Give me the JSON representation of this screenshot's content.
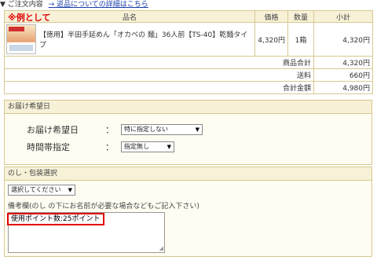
{
  "header": {
    "title": "▼ ご注文内容",
    "link": "→ 返品についての詳細はこちら"
  },
  "order_table": {
    "example_label": "※例として",
    "columns": [
      "品名",
      "価格",
      "数量",
      "小計"
    ],
    "item": {
      "name": "【徳用】半田手延めん「オカベの 麺」36人前【TS-40】乾麺タイプ",
      "price": "4,320円",
      "qty": "1箱",
      "subtotal": "4,320円"
    },
    "summary": [
      {
        "label": "商品合計",
        "value": "4,320円"
      },
      {
        "label": "送料",
        "value": "660円"
      },
      {
        "label": "合計金額",
        "value": "4,980円"
      }
    ]
  },
  "delivery": {
    "title": "お届け希望日",
    "date_label": "お届け希望日",
    "date_colon": "：",
    "date_value": "特に指定しない",
    "time_label": "時間帯指定",
    "time_colon": "：",
    "time_value": "指定無し"
  },
  "noshi": {
    "title": "のし・包装選択",
    "select_value": "選択してください",
    "note_label": "備考欄(のし の下にお名前が必要な場合などもご記入下さい)",
    "note_text": "使用ポイント数:25ポイント"
  }
}
